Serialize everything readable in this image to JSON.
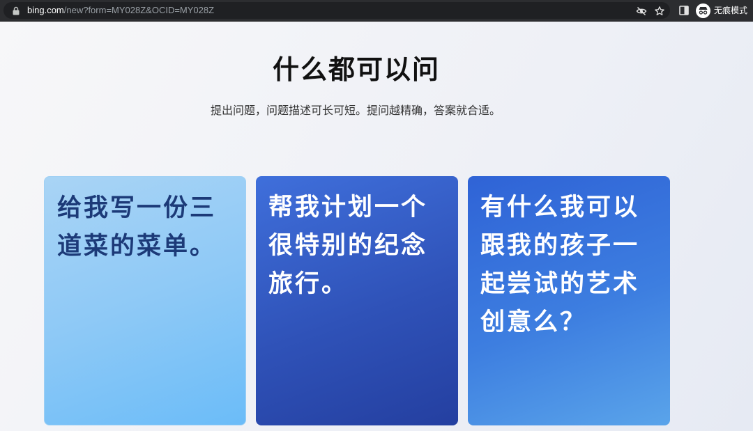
{
  "browser": {
    "url_host": "bing.com",
    "url_path": "/new?form=MY028Z&OCID=MY028Z",
    "incognito_label": "无痕模式",
    "icons": {
      "lock": "lock-icon",
      "tracking": "eye-off-icon",
      "bookmark": "star-icon",
      "side_panel": "side-panel-icon",
      "profile": "incognito-icon"
    }
  },
  "page": {
    "title": "什么都可以问",
    "subtitle": "提出问题，问题描述可长可短。提问越精确，答案就合适。"
  },
  "prompt_cards": [
    {
      "text": "给我写一份三道菜的菜单。",
      "color": "#1c3a78"
    },
    {
      "text": "帮我计划一个很特别的纪念旅行。",
      "color": "#ffffff"
    },
    {
      "text": "有什么我可以跟我的孩子一起尝试的艺术创意么？",
      "color": "#ffffff"
    }
  ],
  "colors": {
    "toolbar": "#2c2d30",
    "card_light": "#8ec9f6",
    "card_dark": "#2f52b8",
    "card_medium": "#3d7ee0"
  }
}
